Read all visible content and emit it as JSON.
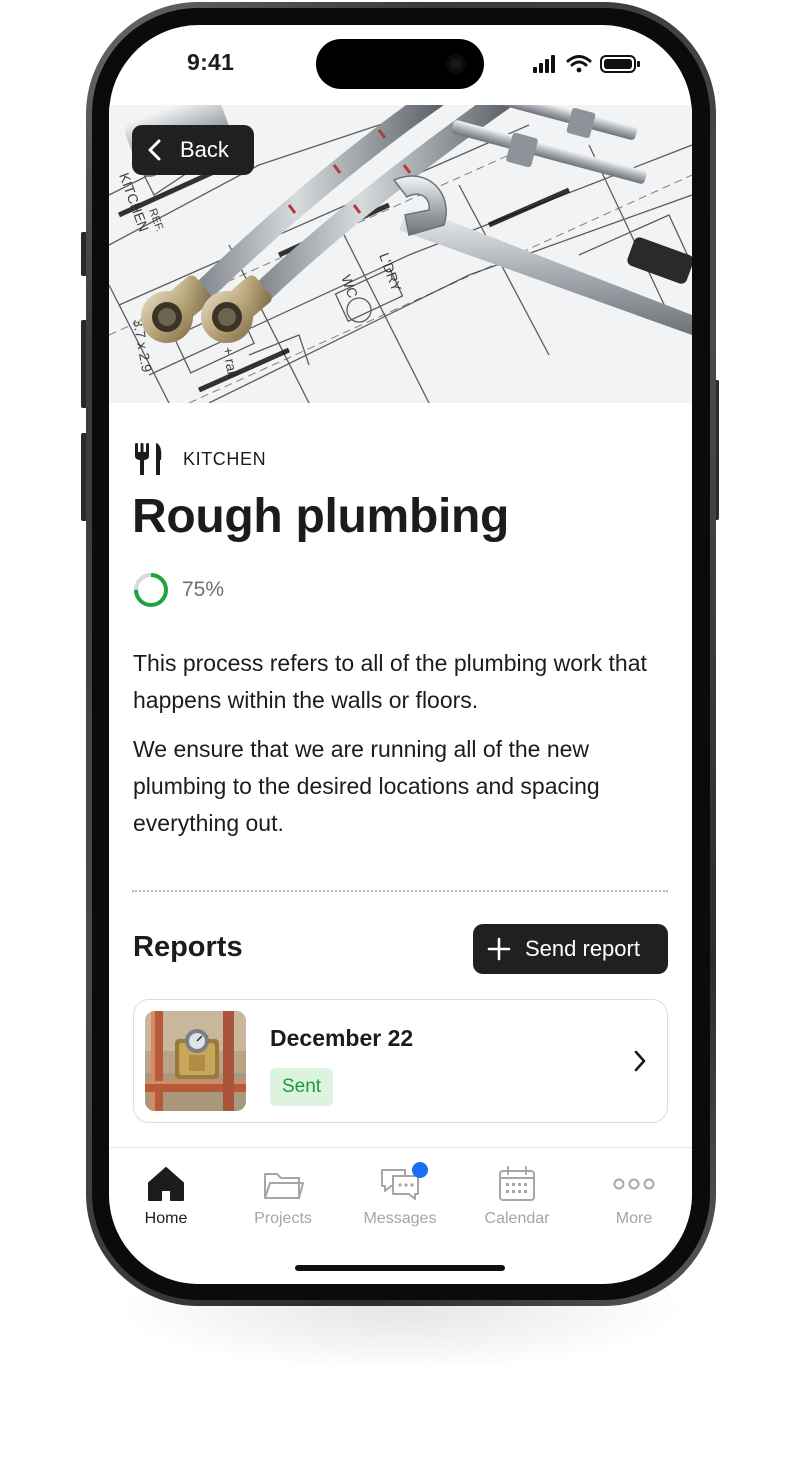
{
  "status_bar": {
    "time": "9:41"
  },
  "hero": {
    "back_label": "Back"
  },
  "task": {
    "category": "KITCHEN",
    "category_icon": "fork-knife-icon",
    "title": "Rough plumbing",
    "progress_percent": 75,
    "progress_label": "75%",
    "description": [
      "This process refers to all of the plumbing work that happens within the walls or floors.",
      "We ensure that we are running all of the new plumbing to the desired locations and spacing everything out."
    ]
  },
  "reports": {
    "heading": "Reports",
    "send_label": "Send report",
    "items": [
      {
        "date": "December 22",
        "status": "Sent"
      }
    ]
  },
  "tabbar": {
    "items": [
      {
        "label": "Home",
        "icon": "home-icon",
        "active": true
      },
      {
        "label": "Projects",
        "icon": "folder-icon",
        "active": false
      },
      {
        "label": "Messages",
        "icon": "chat-icon",
        "active": false,
        "badge": true
      },
      {
        "label": "Calendar",
        "icon": "calendar-icon",
        "active": false
      },
      {
        "label": "More",
        "icon": "more-icon",
        "active": false
      }
    ]
  },
  "colors": {
    "accent_dark": "#1f2022",
    "progress_green": "#1fa33e",
    "badge_bg": "#dbf3df",
    "badge_text": "#1f9a3a",
    "notification_blue": "#1a6ef5"
  }
}
